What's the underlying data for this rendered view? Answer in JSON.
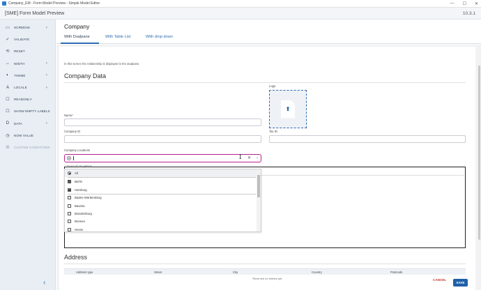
{
  "window": {
    "title": "Company_EM - Form Model Preview - Simple Model Editor",
    "controls": [
      "—",
      "☐",
      "✕"
    ]
  },
  "header": {
    "title": "[SME] Form Model Preview",
    "version": "10.3.1"
  },
  "sidebar": {
    "items": [
      {
        "icon": "screens-icon",
        "glyph": "▭",
        "label": "SCREENS",
        "chevron": "›"
      },
      {
        "icon": "check-icon",
        "glyph": "✓",
        "label": "VALIDATE",
        "chevron": ""
      },
      {
        "icon": "reset-icon",
        "glyph": "⟲",
        "label": "RESET",
        "chevron": ""
      },
      {
        "icon": "width-icon",
        "glyph": "↔",
        "label": "WIDTH",
        "chevron": "›"
      },
      {
        "icon": "theme-icon",
        "glyph": "◐",
        "label": "THEME",
        "chevron": "›"
      },
      {
        "icon": "locale-icon",
        "glyph": "A",
        "label": "LOCALE",
        "chevron": "›"
      },
      {
        "icon": "readonly-icon",
        "glyph": "☐",
        "label": "READONLY",
        "chevron": ""
      },
      {
        "icon": "labels-icon",
        "glyph": "☐",
        "label": "SHOW EMPTY LABELS",
        "chevron": ""
      },
      {
        "icon": "data-icon",
        "glyph": "D",
        "label": "DATA",
        "chevron": "›"
      },
      {
        "icon": "now-value-icon",
        "glyph": "◷",
        "label": "NOW VALUE",
        "chevron": ""
      },
      {
        "icon": "custom-conditions-icon",
        "glyph": "⌘",
        "label": "CUSTOM CONDITIONS",
        "chevron": "",
        "disabled": true
      }
    ],
    "collapse": "‹"
  },
  "page": {
    "title": "Company",
    "tabs": [
      "With Dualpane",
      "With Table List",
      "With drop down"
    ],
    "info": "In this screen the relationship is displayed in the dualpane.",
    "section1": "Company Data",
    "logo_label": "Logo",
    "logo_icon": "⬆",
    "name_label": "Name*",
    "company_id_label": "Company ID",
    "tax_id_label": "Tax ID",
    "locations_label": "Company Locations",
    "combo_clear": "✕",
    "combo_dropdown": "⌄",
    "ibeam": "I",
    "options_count": "10 out of 10 options",
    "options": [
      {
        "label": "All",
        "type": "radio",
        "checked": false
      },
      {
        "label": "Berlin",
        "type": "check",
        "checked": true
      },
      {
        "label": "Hamburg",
        "type": "check",
        "checked": true
      },
      {
        "label": "Baden-Württemberg",
        "type": "check",
        "checked": false
      },
      {
        "label": "Bavaria",
        "type": "check",
        "checked": false
      },
      {
        "label": "Brandenburg",
        "type": "check",
        "checked": false
      },
      {
        "label": "Bremen",
        "type": "check",
        "checked": false
      },
      {
        "label": "Hesse",
        "type": "check",
        "checked": false
      }
    ],
    "section2": "Address",
    "table_columns": [
      "Address type",
      "Street",
      "City",
      "Country",
      "Postcode"
    ],
    "no_entries": "There are no entries yet."
  },
  "footer": {
    "cancel": "CANCEL",
    "save": "SAVE"
  },
  "colors": {
    "accent": "#2b6cb0",
    "focus": "#b5208a",
    "save_bg": "#1f5fa8",
    "cancel": "#c0392b"
  }
}
